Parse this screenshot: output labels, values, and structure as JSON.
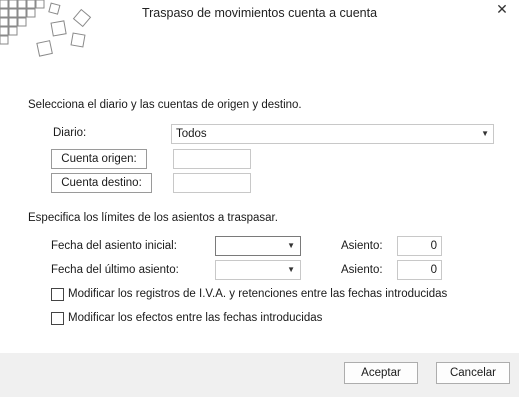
{
  "window": {
    "title": "Traspaso de movimientos cuenta a cuenta",
    "close_icon": "close-icon"
  },
  "section1": {
    "heading": "Selecciona el diario y las cuentas de origen y destino.",
    "diario_label": "Diario:",
    "diario_value": "Todos",
    "cuenta_origen_button": "Cuenta origen:",
    "cuenta_origen_value": "",
    "cuenta_destino_button": "Cuenta destino:",
    "cuenta_destino_value": ""
  },
  "section2": {
    "heading": "Especifica los límites de los asientos a traspasar.",
    "fecha_inicial_label": "Fecha del asiento inicial:",
    "fecha_inicial_value": "",
    "asiento_inicial_label": "Asiento:",
    "asiento_inicial_value": "0",
    "fecha_ultimo_label": "Fecha del último asiento:",
    "fecha_ultimo_value": "",
    "asiento_ultimo_label": "Asiento:",
    "asiento_ultimo_value": "0"
  },
  "options": {
    "iva_label": "Modificar los registros de I.V.A. y retenciones entre las fechas introducidas",
    "iva_checked": false,
    "efectos_label": "Modificar los efectos entre las fechas introducidas",
    "efectos_checked": false
  },
  "footer": {
    "accept_label": "Aceptar",
    "cancel_label": "Cancelar"
  }
}
